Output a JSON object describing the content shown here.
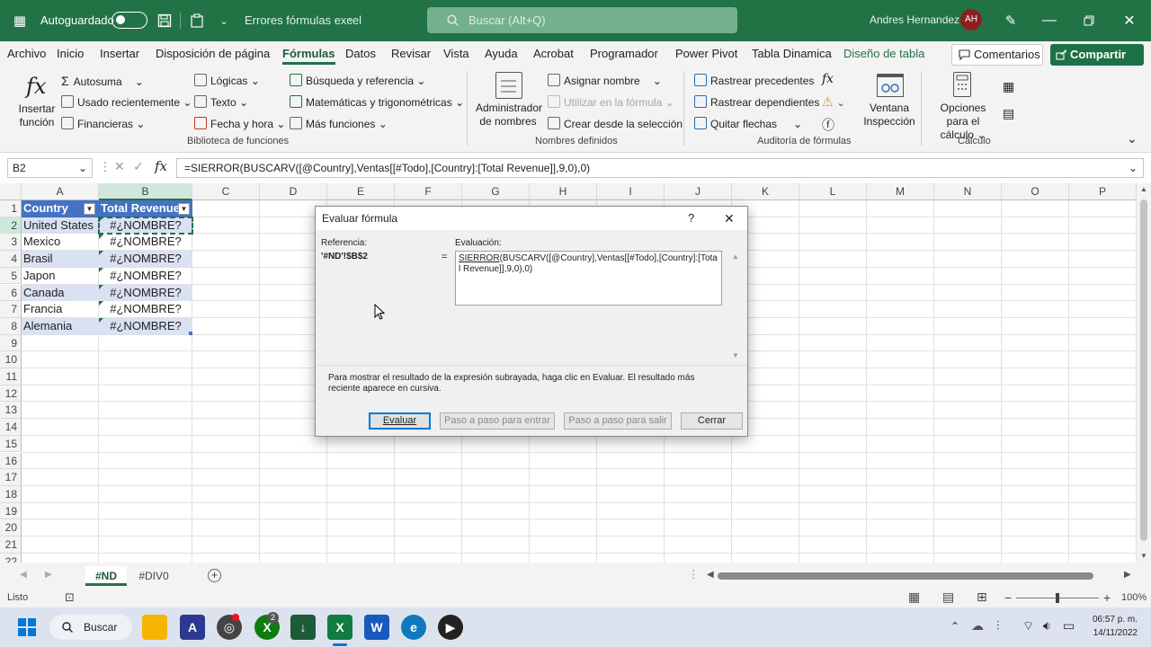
{
  "titlebar": {
    "autosave_label": "Autoguardado",
    "file_name": "Errores fórmulas excel",
    "search_placeholder": "Buscar (Alt+Q)",
    "user_name": "Andres Hernandez",
    "user_initials": "AH"
  },
  "menu": {
    "items": [
      "Archivo",
      "Inicio",
      "Insertar",
      "Disposición de página",
      "Fórmulas",
      "Datos",
      "Revisar",
      "Vista",
      "Ayuda",
      "Acrobat",
      "Programador",
      "Power Pivot",
      "Tabla Dinamica",
      "Diseño de tabla"
    ],
    "active": "Fórmulas",
    "comments_label": "Comentarios",
    "share_label": "Compartir"
  },
  "ribbon": {
    "insert_function": "Insertar función",
    "autosum": "Autosuma",
    "recent": "Usado recientemente",
    "financial": "Financieras",
    "logical": "Lógicas",
    "text": "Texto",
    "datetime": "Fecha y hora",
    "lookup": "Búsqueda y referencia",
    "math": "Matemáticas y trigonométricas",
    "more": "Más funciones",
    "library_group": "Biblioteca de funciones",
    "name_manager": "Administrador de nombres",
    "define_name": "Asignar nombre",
    "use_in_formula": "Utilizar en la fórmula",
    "create_from_sel": "Crear desde la selección",
    "names_group": "Nombres definidos",
    "trace_precedents": "Rastrear precedentes",
    "trace_dependents": "Rastrear dependientes",
    "remove_arrows": "Quitar flechas",
    "watch_window": "Ventana Inspección",
    "auditing_group": "Auditoría de fórmulas",
    "calc_options": "Opciones para el cálculo",
    "calc_group": "Cálculo"
  },
  "formula_bar": {
    "name_box": "B2",
    "formula": "=SIERROR(BUSCARV([@Country],Ventas[[#Todo],[Country]:[Total Revenue]],9,0),0)"
  },
  "sheet": {
    "columns": [
      "A",
      "B",
      "C",
      "D",
      "E",
      "F",
      "G",
      "H",
      "I",
      "J",
      "K",
      "L",
      "M",
      "N",
      "O",
      "P"
    ],
    "rows": [
      "1",
      "2",
      "3",
      "4",
      "5",
      "6",
      "7",
      "8",
      "9",
      "10",
      "11",
      "12",
      "13",
      "14",
      "15",
      "16",
      "17",
      "18",
      "19",
      "20",
      "21",
      "22"
    ],
    "headers": [
      "Country",
      "Total Revenue"
    ],
    "data": [
      [
        "United States",
        "#¿NOMBRE?"
      ],
      [
        "Mexico",
        "#¿NOMBRE?"
      ],
      [
        "Brasil",
        "#¿NOMBRE?"
      ],
      [
        "Japon",
        "#¿NOMBRE?"
      ],
      [
        "Canada",
        "#¿NOMBRE?"
      ],
      [
        "Francia",
        "#¿NOMBRE?"
      ],
      [
        "Alemania",
        "#¿NOMBRE?"
      ]
    ]
  },
  "tabs": [
    "#ND",
    "#DIV0"
  ],
  "status": {
    "ready": "Listo",
    "zoom": "100%"
  },
  "dialog": {
    "title": "Evaluar fórmula",
    "help": "?",
    "ref_label": "Referencia:",
    "ref_value": "'#ND'!$B$2",
    "eq": "=",
    "eval_label": "Evaluación:",
    "eval_underlined": "SIERROR",
    "eval_text": "(BUSCARV([@Country],Ventas[[#Todo],[Country]:[Total Revenue]],9,0),0)",
    "hint": "Para mostrar el resultado de la expresión subrayada, haga clic en Evaluar. El resultado más reciente aparece en cursiva.",
    "btn_evaluate": "Evaluar",
    "btn_step_in": "Paso a paso para entrar",
    "btn_step_out": "Paso a paso para salir",
    "btn_close": "Cerrar"
  },
  "taskbar": {
    "search_label": "Buscar",
    "time": "06:57 p. m.",
    "date": "14/11/2022",
    "xbox_badge": "2"
  }
}
